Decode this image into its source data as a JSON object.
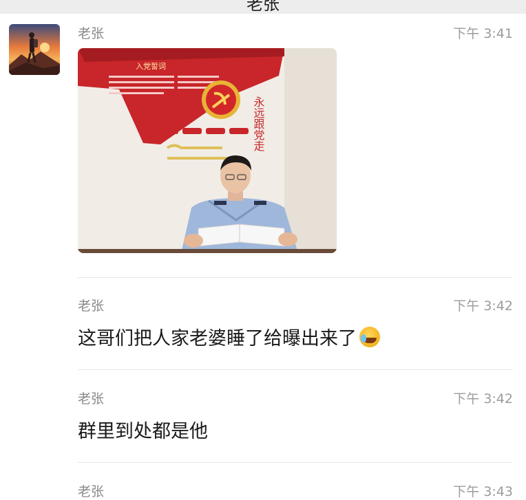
{
  "header": {
    "title": "老张"
  },
  "messages": [
    {
      "sender": "老张",
      "time": "下午 3:41",
      "type": "image",
      "image_icon": "photo-of-police-officer-reading-document"
    },
    {
      "sender": "老张",
      "time": "下午 3:42",
      "type": "text",
      "text": "这哥们把人家老婆睡了给曝出来了",
      "emoji": "laughing-crying-emoji"
    },
    {
      "sender": "老张",
      "time": "下午 3:42",
      "type": "text",
      "text": "群里到处都是他"
    },
    {
      "sender": "老张",
      "time": "下午 3:43",
      "type": "text",
      "text": ""
    }
  ],
  "photo_wall": {
    "banner_title": "入党誓词",
    "slogan": "永远跟党走"
  },
  "colors": {
    "background": "#ffffff",
    "sender": "#8a8a8a",
    "time": "#9b9b9b",
    "text": "#1a1a1a",
    "party_red": "#c8262a"
  }
}
